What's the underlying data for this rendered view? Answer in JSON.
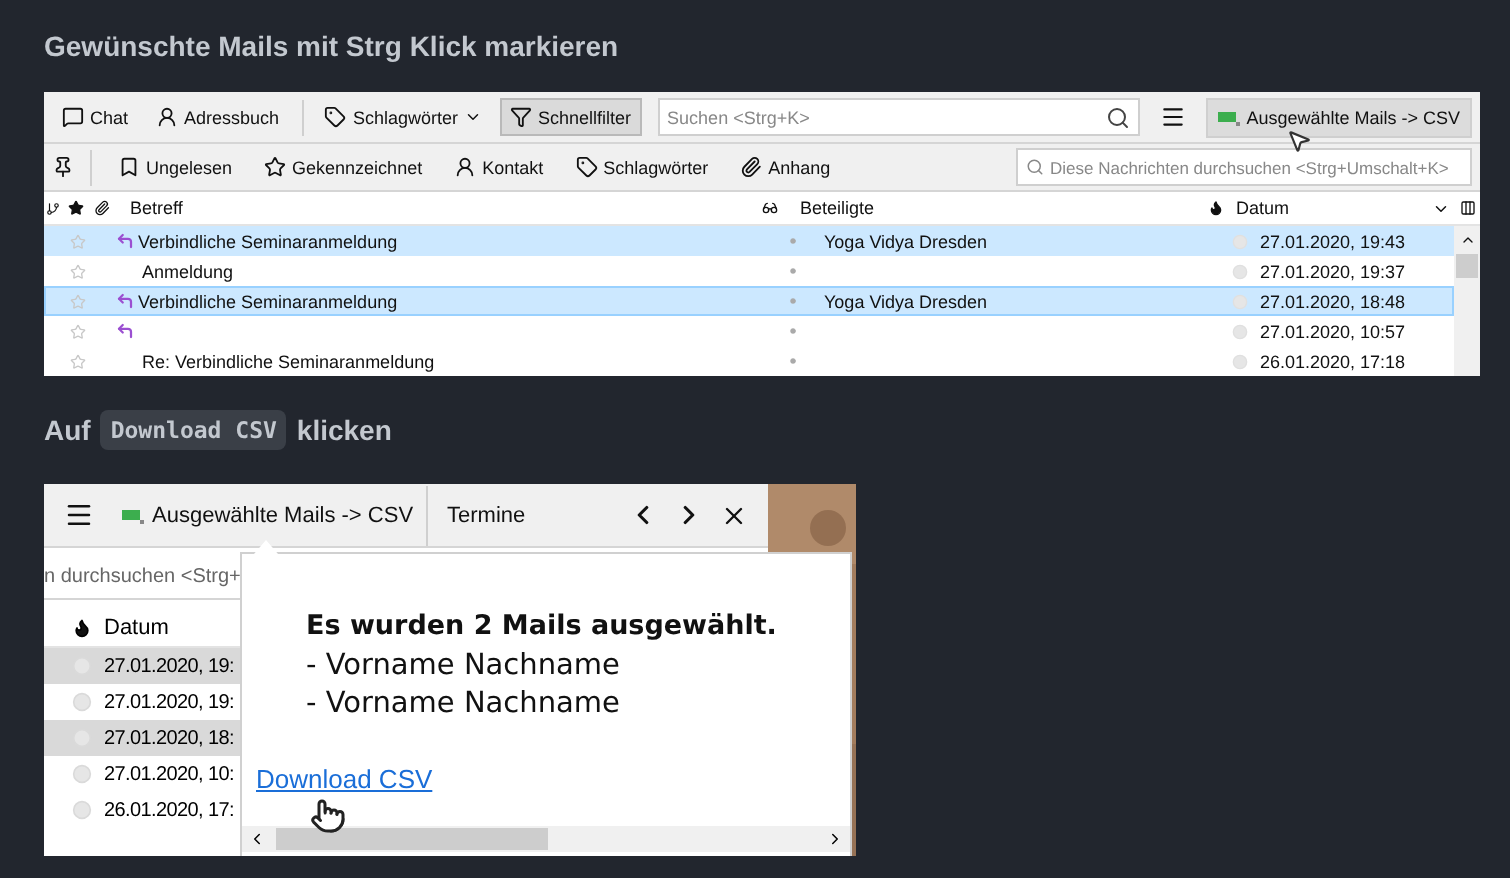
{
  "heading": "Gewünschte Mails mit Strg Klick markieren",
  "mail_list": {
    "toolbar": {
      "buttons": [
        {
          "kind": "chat",
          "label": "Chat",
          "pressed": false
        },
        {
          "kind": "contacts",
          "label": "Adressbuch",
          "pressed": false
        },
        {
          "kind": "tags",
          "label": "Schlagwörter",
          "pressed": false
        },
        {
          "kind": "filter",
          "label": "Schnellfilter",
          "pressed": true
        }
      ],
      "search": {
        "placeholder": "Suchen <Strg+K>"
      },
      "csv_button": "Ausgewählte Mails -> CSV"
    },
    "filter_bar": {
      "items": [
        {
          "kind": "unread",
          "label": "Ungelesen"
        },
        {
          "kind": "flagged",
          "label": "Gekennzeichnet"
        },
        {
          "kind": "contact",
          "label": "Kontakt"
        },
        {
          "kind": "tags",
          "label": "Schlagwörter"
        },
        {
          "kind": "attachment",
          "label": "Anhang"
        }
      ],
      "search": {
        "placeholder": "Diese Nachrichten durchsuchen <Strg+Umschalt+K>"
      }
    },
    "columns": {
      "subject": "Betreff",
      "correspondents": "Beteiligte",
      "date": "Datum"
    },
    "rows": [
      {
        "subject": "Verbindliche Seminaranmeldung",
        "replied": true,
        "starred": false,
        "correspondent": "Yoga Vidya Dresden",
        "date": "27.01.2020, 19:43",
        "selected": true,
        "focused": false
      },
      {
        "subject": "Anmeldung",
        "replied": false,
        "starred": false,
        "date": "27.01.2020, 19:37",
        "selected": false,
        "focused": false
      },
      {
        "subject": "Verbindliche Seminaranmeldung",
        "replied": true,
        "starred": false,
        "correspondent": "Yoga Vidya Dresden",
        "date": "27.01.2020, 18:48",
        "selected": true,
        "focused": true
      },
      {
        "replied": true,
        "starred": false,
        "date": "27.01.2020, 10:57",
        "selected": false,
        "focused": false
      },
      {
        "subject": "Re: Verbindliche Seminaranmeldung",
        "replied": false,
        "starred": false,
        "date": "26.01.2020, 17:18",
        "selected": false,
        "focused": false
      }
    ]
  },
  "step2": {
    "before": "Auf",
    "code": "Download CSV",
    "after": "klicken"
  },
  "csv_window": {
    "csv_button": "Ausgewählte Mails -> CSV",
    "panel_title": "Termine",
    "search_text": "n durchsuchen <Strg+",
    "date_column": "Datum",
    "rows": [
      {
        "date": "27.01.2020, 19:",
        "selected": true
      },
      {
        "date": "27.01.2020, 19:",
        "selected": false
      },
      {
        "date": "27.01.2020, 18:",
        "selected": true
      },
      {
        "date": "27.01.2020, 10:",
        "selected": false
      },
      {
        "date": "26.01.2020, 17:",
        "selected": false
      }
    ],
    "popup": {
      "title": "Es wurden 2 Mails ausgewählt.",
      "names": [
        "- Vorname Nachname",
        "- Vorname Nachname"
      ],
      "link": "Download CSV"
    }
  }
}
